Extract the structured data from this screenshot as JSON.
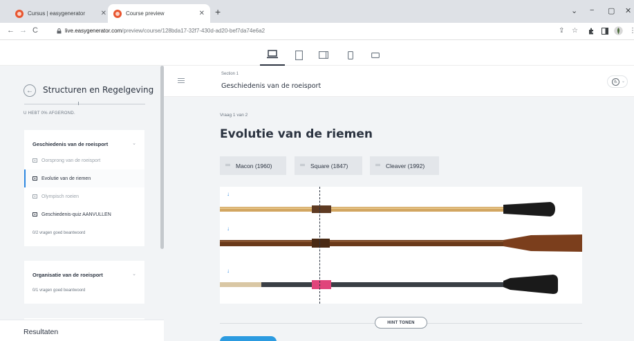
{
  "browser": {
    "tabs": [
      {
        "label": "Cursus | easygenerator",
        "active": false
      },
      {
        "label": "Course preview",
        "active": true
      }
    ],
    "url_host": "live.easygenerator.com",
    "url_path": "/preview/course/128bda17-32f7-430d-ad20-bef7da74e6a2",
    "icons": {
      "new_tab": "+",
      "back": "←",
      "forward": "→",
      "reload": "C",
      "share": "⇪",
      "star": "☆",
      "minimize": "−",
      "maximize": "▢",
      "close": "✕"
    }
  },
  "devices": [
    "desktop-icon",
    "tablet-portrait-icon",
    "tablet-landscape-icon",
    "phone-portrait-icon",
    "phone-landscape-icon"
  ],
  "sidebar": {
    "course_title": "Structuren en Regelgeving",
    "progress_text": "U HEBT 0% AFGEROND.",
    "progress_value": 0,
    "sections": [
      {
        "title": "Geschiedenis van de roeisport",
        "items": [
          {
            "label": "Oorsprong van de roeisport",
            "state": "disabled"
          },
          {
            "label": "Evolutie van de riemen",
            "state": "current"
          },
          {
            "label": "Olympisch roeien",
            "state": "disabled"
          },
          {
            "label": "Geschiedenis-quiz AANVULLEN",
            "state": "normal"
          }
        ],
        "footer": "0/2 vragen goed beantwoord"
      },
      {
        "title": "Organisatie van de roeisport",
        "items": [],
        "footer": "0/1 vragen goed beantwoord"
      }
    ],
    "results_label": "Resultaten"
  },
  "header": {
    "section_label": "Section 1",
    "section_title": "Geschiedenis van de roeisport",
    "accessibility_icon": "accessibility-icon"
  },
  "question": {
    "counter": "Vraag 1 van 2",
    "title": "Evolutie van de riemen",
    "chips": [
      "Macon (1960)",
      "Square (1847)",
      "Cleaver (1992)"
    ],
    "hint_label": "HINT TONEN"
  },
  "colors": {
    "accent": "#2b86e0",
    "submit": "#2c9be0",
    "sidebar_bg": "#f2f4f6",
    "text": "#2b3340"
  }
}
